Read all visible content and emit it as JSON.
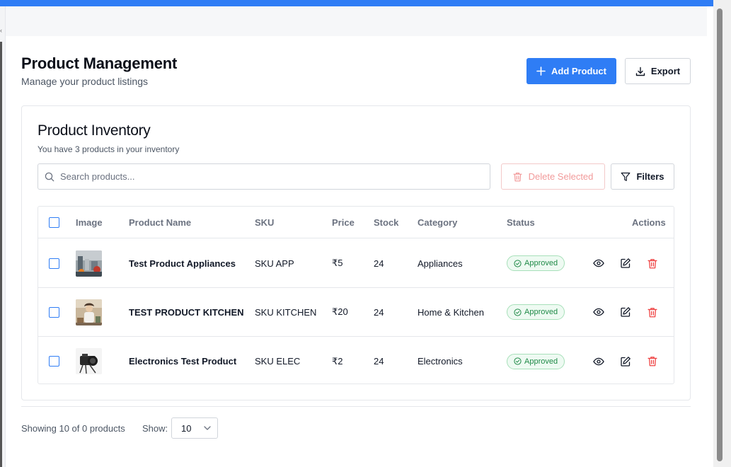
{
  "page": {
    "title": "Product Management",
    "subtitle": "Manage your product listings"
  },
  "header_actions": {
    "add_product": "Add Product",
    "export": "Export"
  },
  "inventory": {
    "title": "Product Inventory",
    "subtitle": "You have 3 products in your inventory",
    "search_placeholder": "Search products...",
    "delete_selected": "Delete Selected",
    "filters": "Filters"
  },
  "table": {
    "columns": [
      "Image",
      "Product Name",
      "SKU",
      "Price",
      "Stock",
      "Category",
      "Status",
      "Actions"
    ],
    "rows": [
      {
        "name": "Test Product Appliances",
        "sku": "SKU APP",
        "price": "₹5",
        "stock": "24",
        "category": "Appliances",
        "status": "Approved",
        "image": "appliances-photo"
      },
      {
        "name": "TEST PRODUCT KITCHEN",
        "sku": "SKU KITCHEN",
        "price": "₹20",
        "stock": "24",
        "category": "Home & Kitchen",
        "status": "Approved",
        "image": "kitchen-photo"
      },
      {
        "name": "Electronics Test Product",
        "sku": "SKU ELEC",
        "price": "₹2",
        "stock": "24",
        "category": "Electronics",
        "status": "Approved",
        "image": "camera-photo"
      }
    ]
  },
  "footer": {
    "showing": "Showing 10 of 0 products",
    "show_label": "Show:",
    "page_size": "10"
  },
  "colors": {
    "accent": "#2f7df5",
    "danger": "#ef4444",
    "success": "#1f8a47"
  },
  "icons": [
    "plus-icon",
    "download-icon",
    "search-icon",
    "trash-icon",
    "filter-icon",
    "eye-icon",
    "edit-icon",
    "check-circle-icon",
    "chevron-down-icon"
  ]
}
